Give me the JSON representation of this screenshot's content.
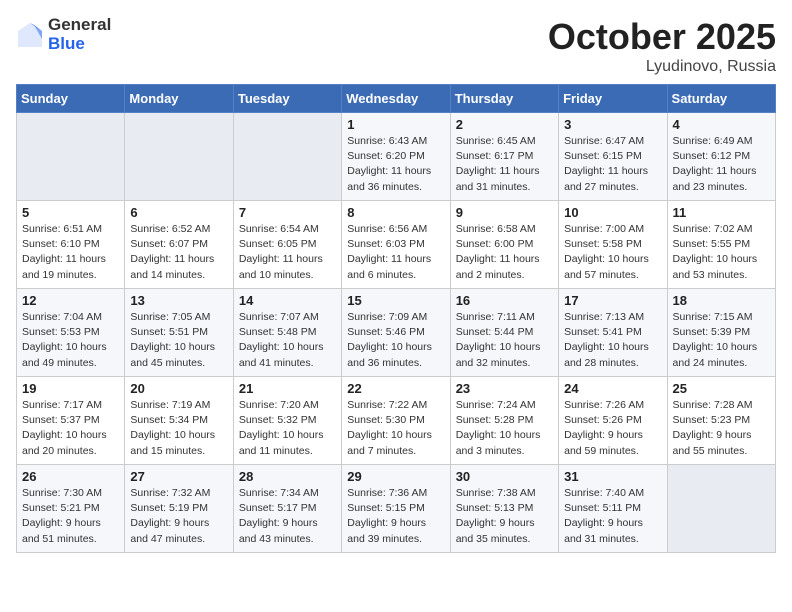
{
  "logo": {
    "general": "General",
    "blue": "Blue"
  },
  "title": "October 2025",
  "location": "Lyudinovo, Russia",
  "weekdays": [
    "Sunday",
    "Monday",
    "Tuesday",
    "Wednesday",
    "Thursday",
    "Friday",
    "Saturday"
  ],
  "weeks": [
    [
      {
        "day": "",
        "info": ""
      },
      {
        "day": "",
        "info": ""
      },
      {
        "day": "",
        "info": ""
      },
      {
        "day": "1",
        "info": "Sunrise: 6:43 AM\nSunset: 6:20 PM\nDaylight: 11 hours\nand 36 minutes."
      },
      {
        "day": "2",
        "info": "Sunrise: 6:45 AM\nSunset: 6:17 PM\nDaylight: 11 hours\nand 31 minutes."
      },
      {
        "day": "3",
        "info": "Sunrise: 6:47 AM\nSunset: 6:15 PM\nDaylight: 11 hours\nand 27 minutes."
      },
      {
        "day": "4",
        "info": "Sunrise: 6:49 AM\nSunset: 6:12 PM\nDaylight: 11 hours\nand 23 minutes."
      }
    ],
    [
      {
        "day": "5",
        "info": "Sunrise: 6:51 AM\nSunset: 6:10 PM\nDaylight: 11 hours\nand 19 minutes."
      },
      {
        "day": "6",
        "info": "Sunrise: 6:52 AM\nSunset: 6:07 PM\nDaylight: 11 hours\nand 14 minutes."
      },
      {
        "day": "7",
        "info": "Sunrise: 6:54 AM\nSunset: 6:05 PM\nDaylight: 11 hours\nand 10 minutes."
      },
      {
        "day": "8",
        "info": "Sunrise: 6:56 AM\nSunset: 6:03 PM\nDaylight: 11 hours\nand 6 minutes."
      },
      {
        "day": "9",
        "info": "Sunrise: 6:58 AM\nSunset: 6:00 PM\nDaylight: 11 hours\nand 2 minutes."
      },
      {
        "day": "10",
        "info": "Sunrise: 7:00 AM\nSunset: 5:58 PM\nDaylight: 10 hours\nand 57 minutes."
      },
      {
        "day": "11",
        "info": "Sunrise: 7:02 AM\nSunset: 5:55 PM\nDaylight: 10 hours\nand 53 minutes."
      }
    ],
    [
      {
        "day": "12",
        "info": "Sunrise: 7:04 AM\nSunset: 5:53 PM\nDaylight: 10 hours\nand 49 minutes."
      },
      {
        "day": "13",
        "info": "Sunrise: 7:05 AM\nSunset: 5:51 PM\nDaylight: 10 hours\nand 45 minutes."
      },
      {
        "day": "14",
        "info": "Sunrise: 7:07 AM\nSunset: 5:48 PM\nDaylight: 10 hours\nand 41 minutes."
      },
      {
        "day": "15",
        "info": "Sunrise: 7:09 AM\nSunset: 5:46 PM\nDaylight: 10 hours\nand 36 minutes."
      },
      {
        "day": "16",
        "info": "Sunrise: 7:11 AM\nSunset: 5:44 PM\nDaylight: 10 hours\nand 32 minutes."
      },
      {
        "day": "17",
        "info": "Sunrise: 7:13 AM\nSunset: 5:41 PM\nDaylight: 10 hours\nand 28 minutes."
      },
      {
        "day": "18",
        "info": "Sunrise: 7:15 AM\nSunset: 5:39 PM\nDaylight: 10 hours\nand 24 minutes."
      }
    ],
    [
      {
        "day": "19",
        "info": "Sunrise: 7:17 AM\nSunset: 5:37 PM\nDaylight: 10 hours\nand 20 minutes."
      },
      {
        "day": "20",
        "info": "Sunrise: 7:19 AM\nSunset: 5:34 PM\nDaylight: 10 hours\nand 15 minutes."
      },
      {
        "day": "21",
        "info": "Sunrise: 7:20 AM\nSunset: 5:32 PM\nDaylight: 10 hours\nand 11 minutes."
      },
      {
        "day": "22",
        "info": "Sunrise: 7:22 AM\nSunset: 5:30 PM\nDaylight: 10 hours\nand 7 minutes."
      },
      {
        "day": "23",
        "info": "Sunrise: 7:24 AM\nSunset: 5:28 PM\nDaylight: 10 hours\nand 3 minutes."
      },
      {
        "day": "24",
        "info": "Sunrise: 7:26 AM\nSunset: 5:26 PM\nDaylight: 9 hours\nand 59 minutes."
      },
      {
        "day": "25",
        "info": "Sunrise: 7:28 AM\nSunset: 5:23 PM\nDaylight: 9 hours\nand 55 minutes."
      }
    ],
    [
      {
        "day": "26",
        "info": "Sunrise: 7:30 AM\nSunset: 5:21 PM\nDaylight: 9 hours\nand 51 minutes."
      },
      {
        "day": "27",
        "info": "Sunrise: 7:32 AM\nSunset: 5:19 PM\nDaylight: 9 hours\nand 47 minutes."
      },
      {
        "day": "28",
        "info": "Sunrise: 7:34 AM\nSunset: 5:17 PM\nDaylight: 9 hours\nand 43 minutes."
      },
      {
        "day": "29",
        "info": "Sunrise: 7:36 AM\nSunset: 5:15 PM\nDaylight: 9 hours\nand 39 minutes."
      },
      {
        "day": "30",
        "info": "Sunrise: 7:38 AM\nSunset: 5:13 PM\nDaylight: 9 hours\nand 35 minutes."
      },
      {
        "day": "31",
        "info": "Sunrise: 7:40 AM\nSunset: 5:11 PM\nDaylight: 9 hours\nand 31 minutes."
      },
      {
        "day": "",
        "info": ""
      }
    ]
  ]
}
